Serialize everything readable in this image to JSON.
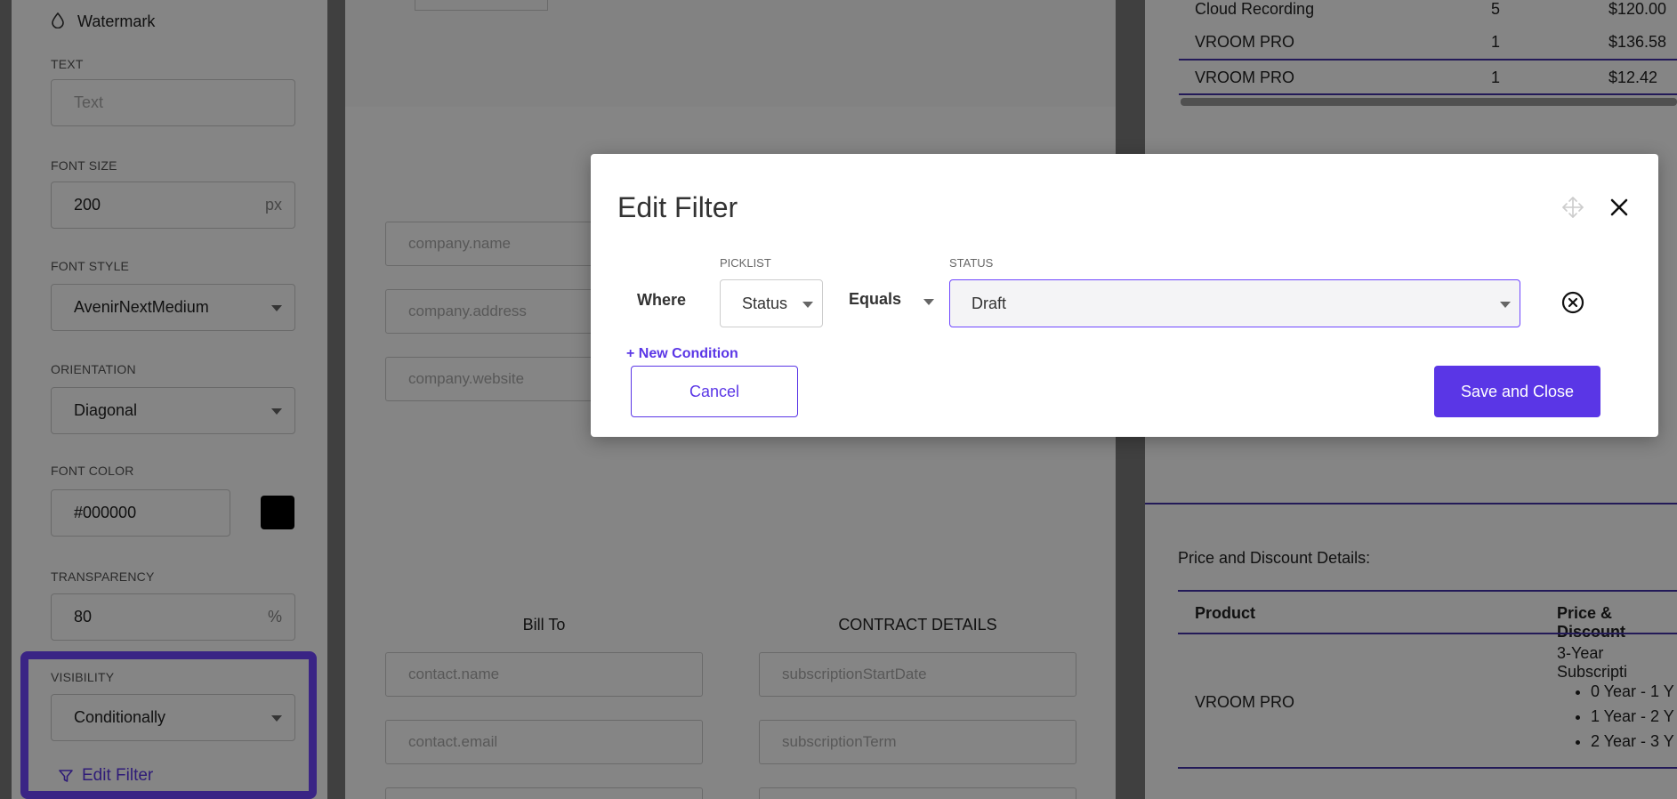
{
  "left_panel": {
    "section_title": "Watermark",
    "text": {
      "label": "TEXT",
      "placeholder": "Text"
    },
    "font_size": {
      "label": "FONT SIZE",
      "value": "200",
      "suffix": "px"
    },
    "font_style": {
      "label": "FONT STYLE",
      "value": "AvenirNextMedium"
    },
    "orientation": {
      "label": "ORIENTATION",
      "value": "Diagonal"
    },
    "font_color": {
      "label": "FONT COLOR",
      "value": "#000000",
      "swatch": "#000000"
    },
    "transparency": {
      "label": "TRANSPARENCY",
      "value": "80",
      "suffix": "%"
    },
    "visibility": {
      "label": "VISIBILITY",
      "value": "Conditionally"
    },
    "edit_filter_label": "Edit Filter"
  },
  "middle_panel": {
    "company_fields": [
      "company.name",
      "company.address",
      "company.website"
    ],
    "bill_to_heading": "Bill To",
    "contract_heading": "CONTRACT DETAILS",
    "bill_to_fields": [
      "contact.name",
      "contact.email"
    ],
    "contract_fields": [
      "subscriptionStartDate",
      "subscriptionTerm"
    ]
  },
  "right_panel": {
    "line_items": [
      {
        "name": "Cloud Recording",
        "qty": "5",
        "price": "$120.00"
      },
      {
        "name": "VROOM PRO",
        "qty": "1",
        "price": "$136.58"
      },
      {
        "name": "VROOM PRO",
        "qty": "1",
        "price": "$12.42"
      }
    ],
    "price_title": "Price and Discount Details:",
    "table": {
      "headers": [
        "Product",
        "Price & Discount"
      ],
      "row_product": "VROOM PRO",
      "row_title": "3-Year Subscripti",
      "row_items": [
        "0 Year - 1 Y",
        "1 Year - 2 Y",
        "2 Year - 3 Y"
      ]
    }
  },
  "modal": {
    "title": "Edit Filter",
    "where_label": "Where",
    "picklist_label": "PICKLIST",
    "picklist_value": "Status",
    "operator_value": "Equals",
    "status_label": "STATUS",
    "status_value": "Draft",
    "new_condition_label": "+ New Condition",
    "cancel_label": "Cancel",
    "save_label": "Save and Close"
  },
  "colors": {
    "accent": "#5a36e6",
    "highlight": "#6f46ff"
  }
}
